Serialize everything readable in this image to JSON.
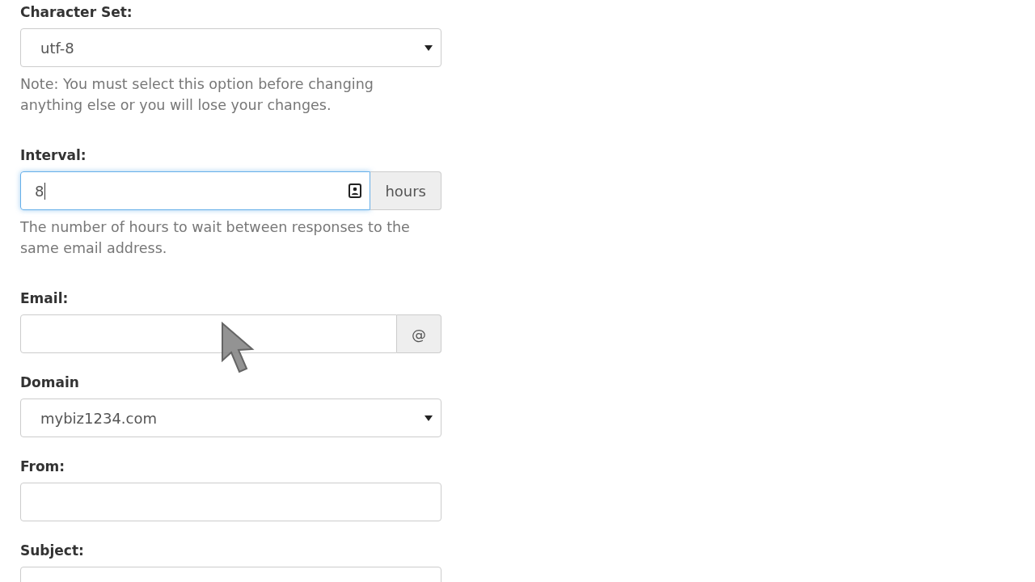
{
  "fields": [
    {
      "kind": "select",
      "label": "Character Set:",
      "value": "utf-8",
      "note": "Note: You must select this option before changing anything else or you will lose your changes."
    },
    {
      "kind": "input",
      "label": "Interval:",
      "value": "8",
      "focused": true,
      "addon": "hours",
      "note": "The number of hours to wait between responses to the same email address."
    },
    {
      "kind": "input",
      "label": "Email:",
      "focused": false,
      "addon": "@"
    },
    {
      "kind": "select",
      "label": "Domain",
      "value": "mybiz1234.com"
    },
    {
      "kind": "input",
      "label": "From:",
      "focused": false
    },
    {
      "kind": "input",
      "label": "Subject:",
      "focused": false
    }
  ]
}
